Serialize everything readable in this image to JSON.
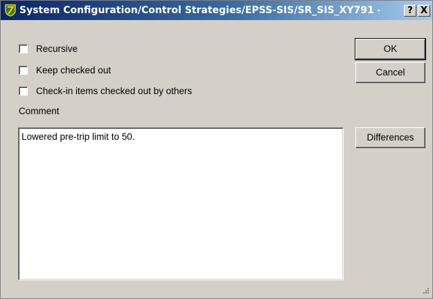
{
  "window": {
    "title": "System Configuration/Control Strategies/EPSS-SIS/SR_SIS_XY791 - ...",
    "help_label": "?",
    "close_label": "X",
    "icon": "app-shield-icon"
  },
  "options": [
    {
      "label": "Recursive",
      "checked": false
    },
    {
      "label": "Keep checked out",
      "checked": false
    },
    {
      "label": "Check-in items checked out by others",
      "checked": false
    }
  ],
  "comment": {
    "label": "Comment",
    "value": "Lowered pre-trip limit to 50."
  },
  "buttons": {
    "ok": "OK",
    "cancel": "Cancel",
    "differences": "Differences"
  },
  "colors": {
    "title_gradient_start": "#0a246a",
    "title_gradient_end": "#a6caf0",
    "dialog_face": "#d4d0c8"
  }
}
